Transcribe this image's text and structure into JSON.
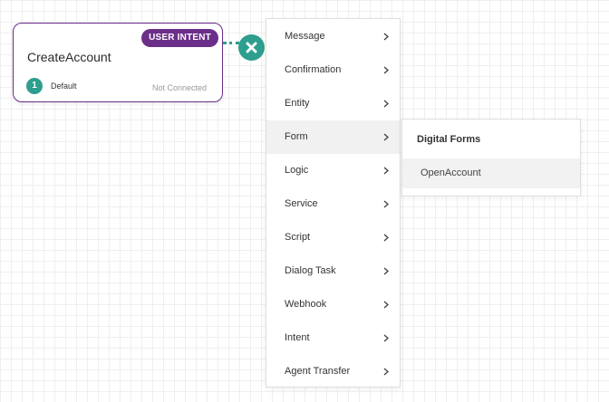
{
  "node": {
    "badge": "USER INTENT",
    "title": "CreateAccount",
    "step_number": "1",
    "step_label": "Default",
    "status": "Not Connected"
  },
  "menu": {
    "items": [
      {
        "label": "Message"
      },
      {
        "label": "Confirmation"
      },
      {
        "label": "Entity"
      },
      {
        "label": "Form"
      },
      {
        "label": "Logic"
      },
      {
        "label": "Service"
      },
      {
        "label": "Script"
      },
      {
        "label": "Dialog Task"
      },
      {
        "label": "Webhook"
      },
      {
        "label": "Intent"
      },
      {
        "label": "Agent Transfer"
      }
    ],
    "active_item": "Form"
  },
  "submenu": {
    "heading": "Digital Forms",
    "items": [
      {
        "label": "OpenAccount"
      }
    ]
  },
  "colors": {
    "accent_purple": "#6b2f8a",
    "accent_teal": "#2e9e8e"
  }
}
